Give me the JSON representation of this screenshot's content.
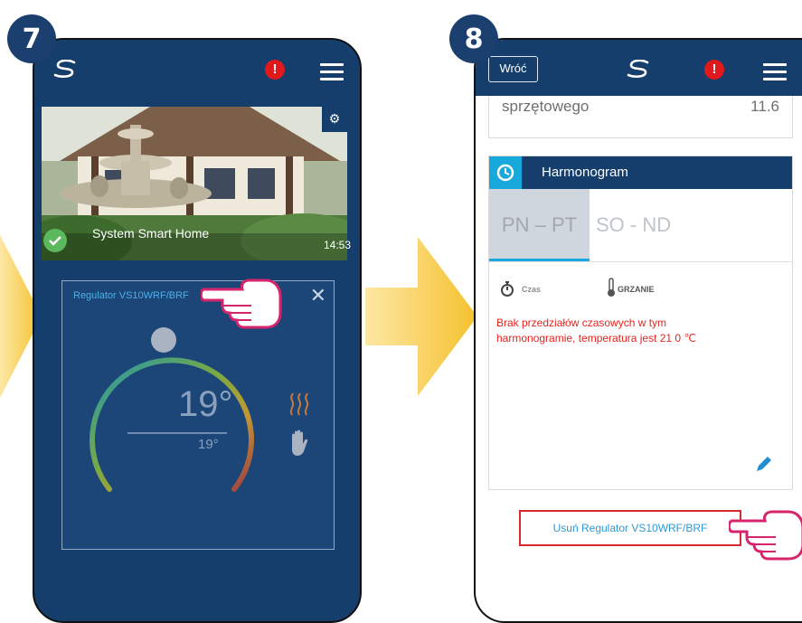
{
  "step1": {
    "number": "7",
    "photo_caption": "System Smart Home",
    "photo_time": "14:53",
    "widget": {
      "title": "Regulator VS10WRF/BRF",
      "temperature": "19°",
      "set_temperature": "19°"
    }
  },
  "step2": {
    "number": "8",
    "back_label": "Wróć",
    "row_label": "sprzętowego",
    "row_value": "11.6",
    "schedule": {
      "title": "Harmonogram",
      "tab_weekdays": "PN – PT",
      "tab_weekend": "SO - ND",
      "time_label": "Czas",
      "heating_label": "GRZANIE",
      "message_line1": "Brak przedziałów czasowych w tym",
      "message_line2": "harmonogramie, temperatura jest 21 0 ℃"
    },
    "remove_label": "Usuń Regulator VS10WRF/BRF"
  },
  "colors": {
    "app_navy": "#153e6c",
    "accent_cyan": "#17a9dc",
    "alert_red": "#e0191c",
    "arrow_yellow": "#f7c948",
    "hand_outline": "#d6256d"
  },
  "icons": [
    "salus-logo-icon",
    "alert-icon",
    "hamburger-menu-icon",
    "gear-icon",
    "check-icon",
    "close-icon",
    "heat-icon",
    "hand-icon",
    "stopwatch-icon",
    "thermometer-icon",
    "pencil-icon",
    "pointing-hand-icon",
    "arrow-icon"
  ]
}
